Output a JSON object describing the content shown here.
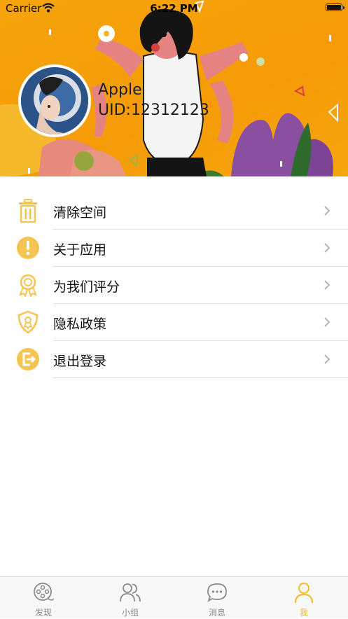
{
  "status_bar": {
    "carrier": "Carrier",
    "time": "6:22 PM"
  },
  "profile": {
    "name": "Apple",
    "uid": "UID:12312123"
  },
  "menu": {
    "items": [
      {
        "label": "清除空间",
        "icon": "trash-icon"
      },
      {
        "label": "关于应用",
        "icon": "info-icon"
      },
      {
        "label": "为我们评分",
        "icon": "award-icon"
      },
      {
        "label": "隐私政策",
        "icon": "shield-icon"
      },
      {
        "label": "退出登录",
        "icon": "logout-icon"
      }
    ]
  },
  "tab_bar": {
    "tabs": [
      {
        "label": "发现",
        "icon": "film-reel-icon",
        "active": false
      },
      {
        "label": "小组",
        "icon": "group-icon",
        "active": false
      },
      {
        "label": "消息",
        "icon": "chat-bubble-icon",
        "active": false
      },
      {
        "label": "我",
        "icon": "person-icon",
        "active": true
      }
    ]
  },
  "colors": {
    "header_orange": "#f59b07",
    "accent_yellow": "#f2b92a",
    "icon_yellow": "#f5c451",
    "tab_inactive": "#8a8a8a"
  }
}
